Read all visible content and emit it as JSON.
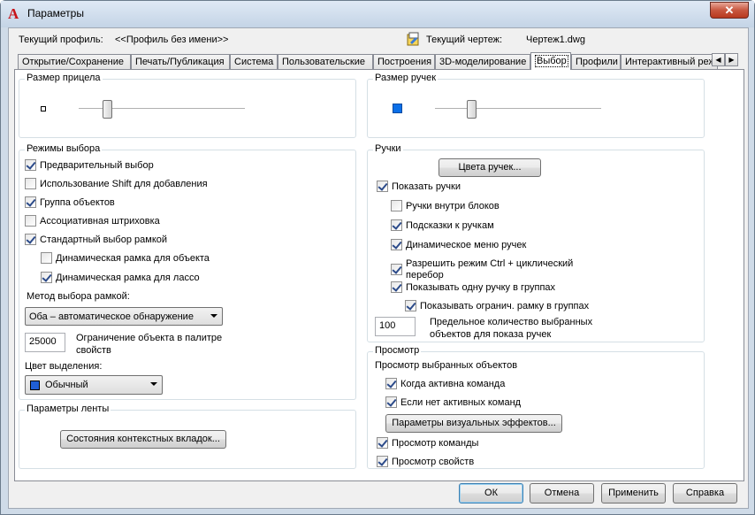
{
  "window": {
    "title": "Параметры",
    "close_label": "✕"
  },
  "header": {
    "profile_label": "Текущий профиль:",
    "profile_value": "<<Профиль без имени>>",
    "drawing_label": "Текущий чертеж:",
    "drawing_value": "Чертеж1.dwg"
  },
  "tabs": [
    {
      "label": "Открытие/Сохранение"
    },
    {
      "label": "Печать/Публикация"
    },
    {
      "label": "Система"
    },
    {
      "label": "Пользовательские"
    },
    {
      "label": "Построения"
    },
    {
      "label": "3D-моделирование"
    },
    {
      "label": "Выбор",
      "active": true
    },
    {
      "label": "Профили"
    },
    {
      "label": "Интерактивный реж"
    }
  ],
  "pickbox": {
    "title": "Размер прицела",
    "slider_level": 0.17
  },
  "grip_size": {
    "title": "Размер ручек",
    "slider_level": 0.22,
    "swatch_color": "#0a6fe8"
  },
  "selection_modes": {
    "title": "Режимы выбора",
    "checkboxes": [
      {
        "label": "Предварительный выбор",
        "checked": true
      },
      {
        "label": "Использование Shift для добавления",
        "checked": false
      },
      {
        "label": "Группа объектов",
        "checked": true
      },
      {
        "label": "Ассоциативная штриховка",
        "checked": false
      },
      {
        "label": "Стандартный выбор рамкой",
        "checked": true
      },
      {
        "label": "Динамическая рамка для объекта",
        "checked": false
      },
      {
        "label": "Динамическая рамка для лассо",
        "checked": true
      }
    ],
    "method_label": "Метод выбора рамкой:",
    "method_value": "Оба – автоматическое обнаружение",
    "limit_value": "25000",
    "limit_label_1": "Ограничение объекта в палитре",
    "limit_label_2": "свойств",
    "color_label": "Цвет выделения:",
    "color_value": "Обычный",
    "color_swatch": "#1f5ed6"
  },
  "ribbon": {
    "title": "Параметры ленты",
    "button_label": "Состояния контекстных вкладок..."
  },
  "grips": {
    "title": "Ручки",
    "color_button": "Цвета ручек...",
    "checkboxes": [
      {
        "label": "Показать ручки",
        "checked": true
      },
      {
        "label": "Ручки внутри блоков",
        "checked": false
      },
      {
        "label": "Подсказки к ручкам",
        "checked": true
      },
      {
        "label": "Динамическое меню ручек",
        "checked": true
      },
      {
        "label": "Разрешить режим Ctrl + циклический",
        "label2": "перебор",
        "checked": true
      },
      {
        "label": "Показывать одну ручку в группах",
        "checked": true
      },
      {
        "label": "Показывать огранич. рамку в группах",
        "checked": true
      }
    ],
    "limit_value": "100",
    "limit_label_1": "Предельное количество выбранных",
    "limit_label_2": "объектов для показа ручек"
  },
  "preview": {
    "title": "Просмотр",
    "subtitle": "Просмотр выбранных объектов",
    "checkboxes": [
      {
        "label": "Когда активна команда",
        "checked": true
      },
      {
        "label": "Если нет активных команд",
        "checked": true
      }
    ],
    "effects_button": "Параметры визуальных эффектов...",
    "checkboxes2": [
      {
        "label": "Просмотр команды",
        "checked": true
      },
      {
        "label": "Просмотр свойств",
        "checked": true
      }
    ]
  },
  "footer": {
    "ok": "ОК",
    "cancel": "Отмена",
    "apply": "Применить",
    "help": "Справка"
  }
}
